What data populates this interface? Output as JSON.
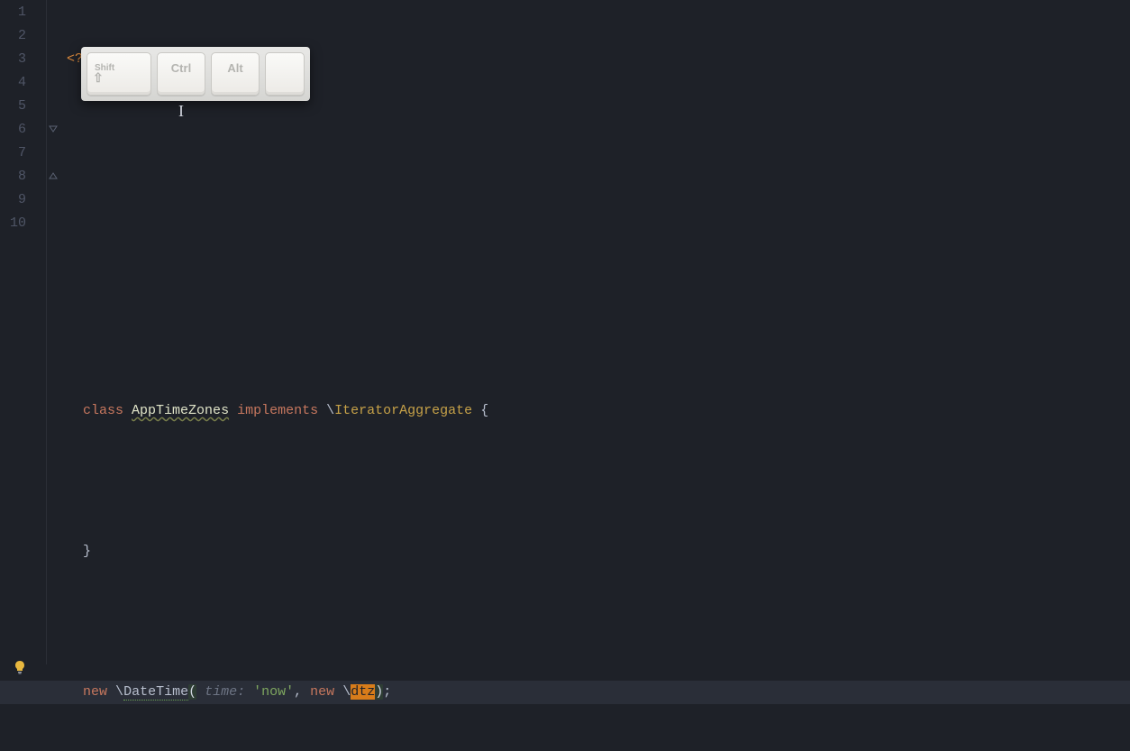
{
  "gutter": {
    "lines": [
      "1",
      "2",
      "3",
      "4",
      "5",
      "6",
      "7",
      "8",
      "9",
      "10"
    ]
  },
  "code": {
    "php_open": "<?php",
    "kw_class": "class",
    "class_name": "AppTimeZones",
    "kw_implements": "implements",
    "ns_sep1": "\\",
    "iface": "IteratorAggregate",
    "brace_open": "{",
    "brace_close": "}",
    "kw_new1": "new",
    "ns_sep2": "\\",
    "fn_datetime": "DateTime",
    "paren_open": "(",
    "hint_time": " time: ",
    "str_now": "'now'",
    "comma": ",",
    "kw_new2": "new",
    "ns_sep3": "\\",
    "sel_dtz": "dtz",
    "paren_close": ")",
    "semi": ";"
  },
  "keycaps": {
    "shift": "Shift",
    "ctrl": "Ctrl",
    "alt": "Alt",
    "blank": ""
  },
  "cursor_glyph": "I"
}
